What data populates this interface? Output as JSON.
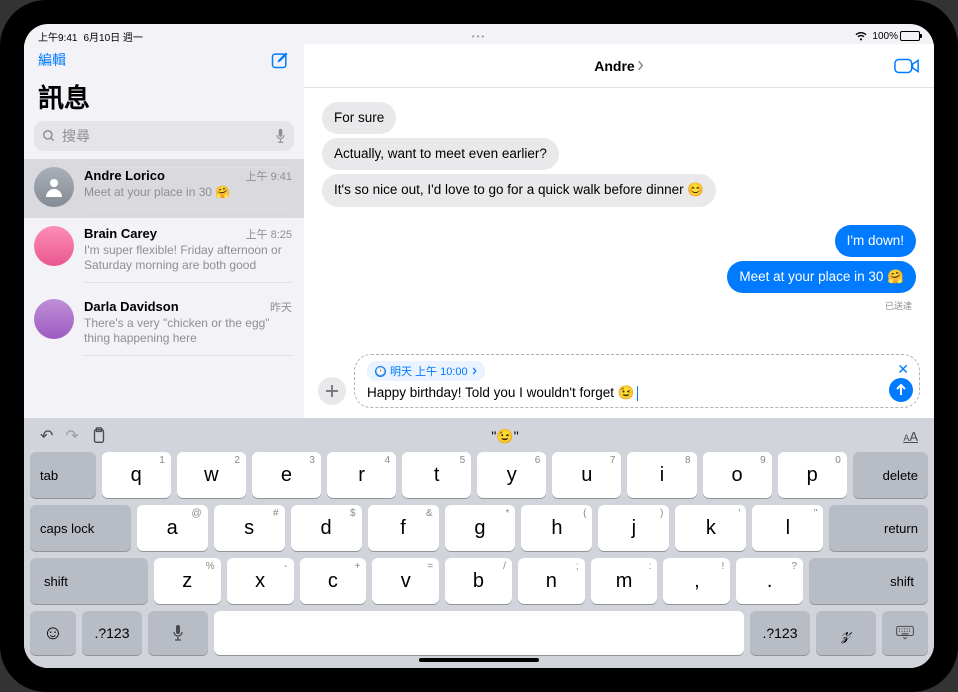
{
  "statusbar": {
    "time": "上午9:41",
    "date": "6月10日 週一",
    "battery": "100%"
  },
  "sidebar": {
    "edit_label": "編輯",
    "title": "訊息",
    "search_placeholder": "搜尋",
    "conversations": [
      {
        "name": "Andre Lorico",
        "time": "上午 9:41",
        "preview": "Meet at your place in 30 🤗"
      },
      {
        "name": "Brain Carey",
        "time": "上午 8:25",
        "preview": "I'm super flexible! Friday afternoon or Saturday morning are both good"
      },
      {
        "name": "Darla Davidson",
        "time": "昨天",
        "preview": "There's a very \"chicken or the egg\" thing happening here"
      }
    ]
  },
  "chat": {
    "contact_name": "Andre",
    "messages": [
      {
        "type": "recv",
        "text": "For sure"
      },
      {
        "type": "recv",
        "text": "Actually, want to meet even earlier?"
      },
      {
        "type": "recv",
        "text": "It's so nice out, I'd love to go for a quick walk before dinner 😊"
      },
      {
        "type": "sent",
        "text": "I'm down!"
      },
      {
        "type": "sent",
        "text": "Meet at your place in 30 🤗"
      }
    ],
    "delivered_label": "已送達",
    "schedule_label": "明天 上午 10:00",
    "compose_text": "Happy birthday! Told you I wouldn't forget 😉"
  },
  "keyboard": {
    "prediction": "\"😉\"",
    "row1": [
      {
        "k": "q",
        "s": "1"
      },
      {
        "k": "w",
        "s": "2"
      },
      {
        "k": "e",
        "s": "3"
      },
      {
        "k": "r",
        "s": "4"
      },
      {
        "k": "t",
        "s": "5"
      },
      {
        "k": "y",
        "s": "6"
      },
      {
        "k": "u",
        "s": "7"
      },
      {
        "k": "i",
        "s": "8"
      },
      {
        "k": "o",
        "s": "9"
      },
      {
        "k": "p",
        "s": "0"
      }
    ],
    "row2": [
      {
        "k": "a",
        "s": "@"
      },
      {
        "k": "s",
        "s": "#"
      },
      {
        "k": "d",
        "s": "$"
      },
      {
        "k": "f",
        "s": "&"
      },
      {
        "k": "g",
        "s": "*"
      },
      {
        "k": "h",
        "s": "("
      },
      {
        "k": "j",
        "s": ")"
      },
      {
        "k": "k",
        "s": "'"
      },
      {
        "k": "l",
        "s": "\""
      }
    ],
    "row3": [
      {
        "k": "z",
        "s": "%"
      },
      {
        "k": "x",
        "s": "-"
      },
      {
        "k": "c",
        "s": "+"
      },
      {
        "k": "v",
        "s": "="
      },
      {
        "k": "b",
        "s": "/"
      },
      {
        "k": "n",
        "s": ";"
      },
      {
        "k": "m",
        "s": ":"
      },
      {
        "k": ",",
        "s": "!"
      },
      {
        "k": ".",
        "s": "?"
      }
    ],
    "tab": "tab",
    "delete": "delete",
    "caps": "caps lock",
    "return": "return",
    "shift": "shift",
    "numkey": ".?123"
  }
}
